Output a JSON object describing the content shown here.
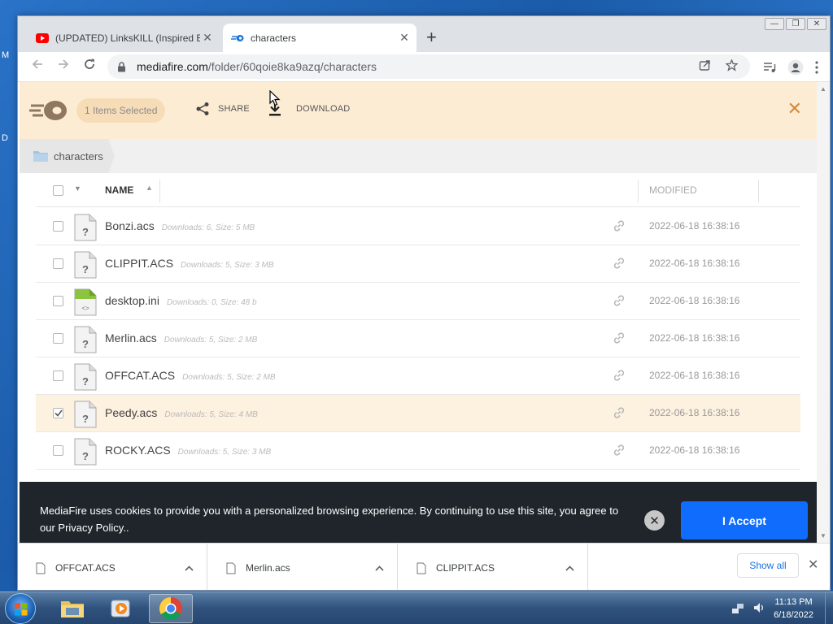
{
  "desktop": {
    "side_letters": [
      "M",
      "D"
    ]
  },
  "browser": {
    "tabs": [
      {
        "title": "(UPDATED) LinksKILL (Inspired By",
        "favicon": "youtube-icon",
        "active": false
      },
      {
        "title": "characters",
        "favicon": "mediafire-icon",
        "active": true
      }
    ],
    "new_tab": "+",
    "address": {
      "host": "mediafire.com",
      "path": "/folder/60qoie8ka9azq/characters"
    },
    "window_controls": [
      "—",
      "❐",
      "✕"
    ]
  },
  "selection_bar": {
    "count_label": "1 Items Selected",
    "share_label": "SHARE",
    "download_label": "DOWNLOAD",
    "close_label": "✕"
  },
  "breadcrumb": {
    "folder": "characters"
  },
  "file_list": {
    "columns": {
      "name": "NAME",
      "modified": "MODIFIED"
    },
    "rows": [
      {
        "name": "Bonzi.acs",
        "meta": "Downloads: 6, Size: 5 MB",
        "modified": "2022-06-18 16:38:16",
        "checked": false,
        "icon": "unknown-file-icon"
      },
      {
        "name": "CLIPPIT.ACS",
        "meta": "Downloads: 5, Size: 3 MB",
        "modified": "2022-06-18 16:38:16",
        "checked": false,
        "icon": "unknown-file-icon"
      },
      {
        "name": "desktop.ini",
        "meta": "Downloads: 0, Size: 48 b",
        "modified": "2022-06-18 16:38:16",
        "checked": false,
        "icon": "code-file-icon"
      },
      {
        "name": "Merlin.acs",
        "meta": "Downloads: 5, Size: 2 MB",
        "modified": "2022-06-18 16:38:16",
        "checked": false,
        "icon": "unknown-file-icon"
      },
      {
        "name": "OFFCAT.ACS",
        "meta": "Downloads: 5, Size: 2 MB",
        "modified": "2022-06-18 16:38:16",
        "checked": false,
        "icon": "unknown-file-icon"
      },
      {
        "name": "Peedy.acs",
        "meta": "Downloads: 5, Size: 4 MB",
        "modified": "2022-06-18 16:38:16",
        "checked": true,
        "icon": "unknown-file-icon"
      },
      {
        "name": "ROCKY.ACS",
        "meta": "Downloads: 5, Size: 3 MB",
        "modified": "2022-06-18 16:38:16",
        "checked": false,
        "icon": "unknown-file-icon"
      }
    ]
  },
  "cookie_banner": {
    "text": "MediaFire uses cookies to provide you with a personalized browsing experience. By continuing to use this site, you agree to our Privacy Policy..",
    "close_label": "✕",
    "accept_label": "I Accept"
  },
  "downloads_shelf": {
    "items": [
      {
        "name": "OFFCAT.ACS"
      },
      {
        "name": "Merlin.acs"
      },
      {
        "name": "CLIPPIT.ACS"
      }
    ],
    "show_all_label": "Show all",
    "close_label": "✕"
  },
  "taskbar": {
    "time": "11:13 PM",
    "date": "6/18/2022"
  },
  "colors": {
    "selection_bar": "#fdecd4",
    "accept_button": "#0f6cfc",
    "cookie_banner": "#1f252b",
    "selected_row": "#fdf1df"
  }
}
